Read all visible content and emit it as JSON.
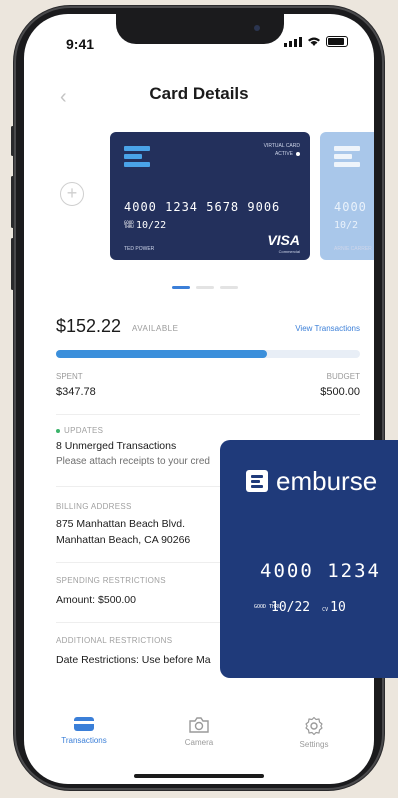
{
  "status": {
    "time": "9:41"
  },
  "header": {
    "title": "Card Details"
  },
  "card": {
    "virtual_label": "VIRTUAL CARD",
    "status": "ACTIVE",
    "number": "4000 1234 5678 9006",
    "expiry": "10/22",
    "good_thru": "GOOD THRU",
    "holder": "TED POWER",
    "network": "VISA",
    "network_sub": "Commercial"
  },
  "next_card": {
    "number": "4000",
    "expiry": "10/2",
    "holder": "ARNIE CARRER"
  },
  "summary": {
    "available_amount": "$152.22",
    "available_label": "AVAILABLE",
    "view_transactions": "View Transactions",
    "spent_label": "SPENT",
    "spent_value": "$347.78",
    "budget_label": "BUDGET",
    "budget_value": "$500.00",
    "spent_fraction": 0.6956
  },
  "updates": {
    "label": "UPDATES",
    "line": "8 Unmerged Transactions",
    "sub": "Please attach receipts to your cred"
  },
  "billing": {
    "label": "BILLING ADDRESS",
    "line1": "875 Manhattan Beach Blvd.",
    "line2": "Manhattan Beach, CA 90266"
  },
  "spending": {
    "label": "SPENDING RESTRICTIONS",
    "line": "Amount:  $500.00"
  },
  "additional": {
    "label": "ADDITIONAL RESTRICTIONS",
    "line": "Date Restrictions:  Use before Ma"
  },
  "promo_card": {
    "brand": "emburse",
    "number": "4000  1234",
    "good_thru": "GOOD THRU",
    "expiry": "10/22",
    "cv_label": "CV",
    "cv_value": "10"
  },
  "tabs": [
    {
      "label": "Transactions",
      "icon": "card-icon"
    },
    {
      "label": "Camera",
      "icon": "camera-icon"
    },
    {
      "label": "Settings",
      "icon": "gear-icon"
    }
  ],
  "colors": {
    "accent": "#3b7fd8",
    "card_navy": "#23305c",
    "promo_navy": "#1f3a7a"
  }
}
